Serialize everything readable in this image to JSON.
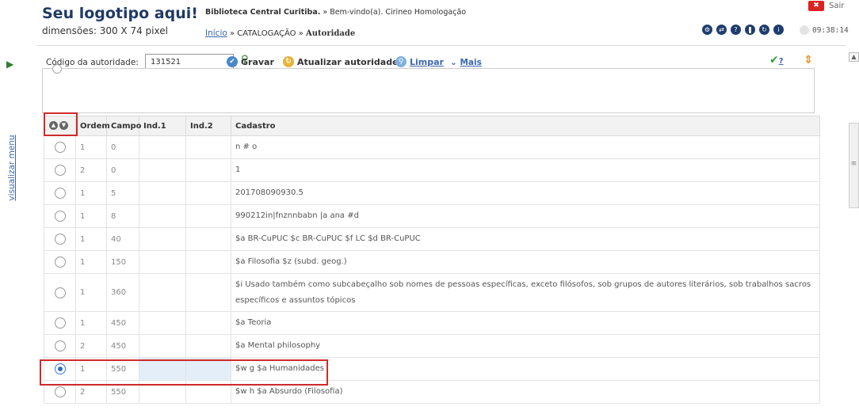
{
  "header": {
    "logo_title": "Seu logotipo aqui!",
    "logo_subtitle": "dimensões: 300 X 74 pixel",
    "library_name": "Biblioteca Central Curitiba.",
    "welcome": " » Bem-vindo(a). Cirineo Homologação",
    "crumb_home": "Início",
    "crumb_section": "» CATALOGAÇÃO »",
    "crumb_current": "Autoridade",
    "exit_label": "Sair",
    "clock": "09:38:14",
    "nav_icons": [
      "settings-icon",
      "exchange-icon",
      "help-icon",
      "pause-icon",
      "refresh-icon",
      "info-icon"
    ]
  },
  "sidebar": {
    "menu_label": "visualizar menu"
  },
  "toolbar": {
    "code_label": "Código da autoridade:",
    "code_value": "131521",
    "save_label": "Gravar",
    "update_label": "Atualizar autoridade",
    "clear_label": "Limpar",
    "more_label": "Mais",
    "check_label": "?"
  },
  "table": {
    "columns": [
      "Ordem",
      "Campo",
      "Ind.1",
      "Ind.2",
      "Cadastro"
    ],
    "rows": [
      {
        "ordem": "1",
        "campo": "0",
        "ind1": "",
        "ind2": "",
        "cadastro": "n # o",
        "selected": false
      },
      {
        "ordem": "2",
        "campo": "0",
        "ind1": "",
        "ind2": "",
        "cadastro": "1",
        "selected": false
      },
      {
        "ordem": "1",
        "campo": "5",
        "ind1": "",
        "ind2": "",
        "cadastro": "201708090930.5",
        "selected": false
      },
      {
        "ordem": "1",
        "campo": "8",
        "ind1": "",
        "ind2": "",
        "cadastro": "990212in|fnznnbabn |a ana #d",
        "selected": false
      },
      {
        "ordem": "1",
        "campo": "40",
        "ind1": "",
        "ind2": "",
        "cadastro": "$a BR-CuPUC $c BR-CuPUC $f LC $d BR-CuPUC",
        "selected": false
      },
      {
        "ordem": "1",
        "campo": "150",
        "ind1": "",
        "ind2": "",
        "cadastro": "$a Filosofia $z (subd. geog.)",
        "selected": false
      },
      {
        "ordem": "1",
        "campo": "360",
        "ind1": "",
        "ind2": "",
        "cadastro": "$i Usado também como subcabeçalho sob nomes de pessoas específicas, exceto filósofos, sob grupos de autores literários, sob trabalhos sacros específicos e assuntos tópicos",
        "selected": false
      },
      {
        "ordem": "1",
        "campo": "450",
        "ind1": "",
        "ind2": "",
        "cadastro": "$a Teoria",
        "selected": false
      },
      {
        "ordem": "2",
        "campo": "450",
        "ind1": "",
        "ind2": "",
        "cadastro": "$a Mental philosophy",
        "selected": false
      },
      {
        "ordem": "1",
        "campo": "550",
        "ind1": "",
        "ind2": "",
        "cadastro": "$w g $a Humanidades",
        "selected": true
      },
      {
        "ordem": "2",
        "campo": "550",
        "ind1": "",
        "ind2": "",
        "cadastro": "$w h $a Absurdo (Filosofia)",
        "selected": false
      }
    ]
  },
  "colors": {
    "brand": "#1f3a66",
    "link": "#3b67b0",
    "highlight": "#d02a2a",
    "selected_cell": "#e3eef8"
  }
}
